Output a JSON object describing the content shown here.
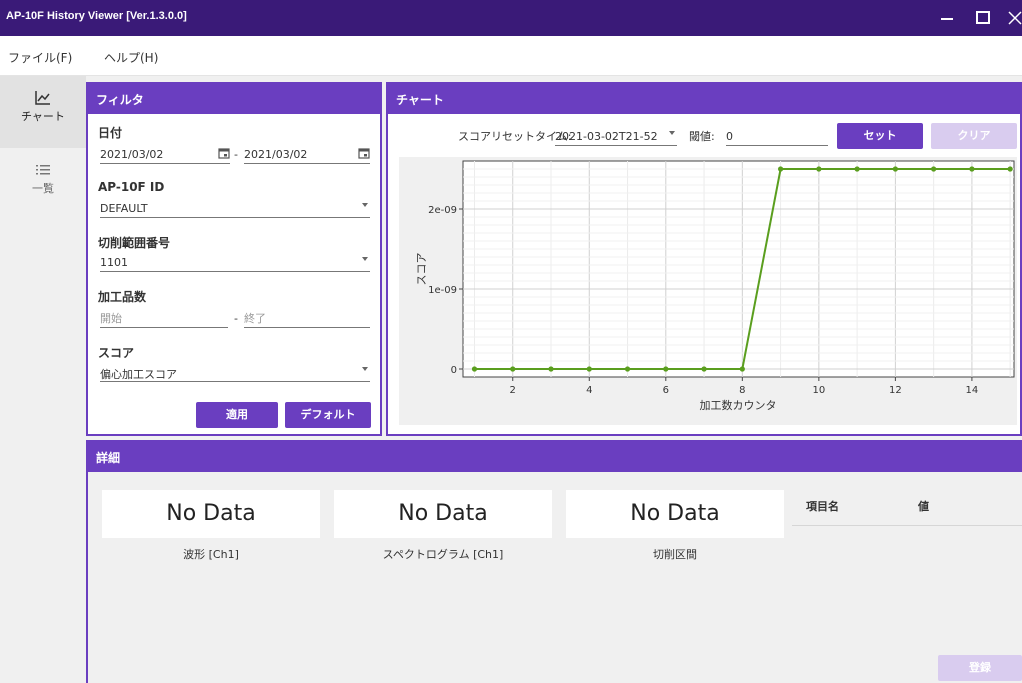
{
  "window": {
    "title": "AP-10F History Viewer [Ver.1.3.0.0]"
  },
  "menu": {
    "file": "ファイル(F)",
    "help": "ヘルプ(H)"
  },
  "nav": {
    "chart": "チャート",
    "list": "一覧"
  },
  "filter": {
    "title": "フィルタ",
    "date_label": "日付",
    "date_from": "2021/03/02",
    "date_sep": "-",
    "date_to": "2021/03/02",
    "id_label": "AP-10F ID",
    "id_value": "DEFAULT",
    "range_label": "切削範囲番号",
    "range_value": "1101",
    "count_label": "加工品数",
    "count_start_placeholder": "開始",
    "count_sep": "-",
    "count_end_placeholder": "終了",
    "score_label": "スコア",
    "score_value": "偏心加工スコア",
    "apply_button": "適用",
    "default_button": "デフォルト"
  },
  "chart_panel": {
    "title": "チャート",
    "reset_time_label": "スコアリセットタイム:",
    "reset_time_value": "2021-03-02T21-52",
    "threshold_label": "閾値:",
    "threshold_value": "0",
    "set_button": "セット",
    "clear_button": "クリア"
  },
  "chart_data": {
    "type": "line",
    "xlabel": "加工数カウンタ",
    "ylabel": "スコア",
    "xlim": [
      1,
      15
    ],
    "ylim": [
      0,
      2.5e-09
    ],
    "xticks": [
      2,
      4,
      6,
      8,
      10,
      12,
      14
    ],
    "xtick_labels": [
      "2",
      "4",
      "6",
      "8",
      "10",
      "12",
      "14"
    ],
    "yticks": [
      0,
      1e-09,
      2e-09
    ],
    "ytick_labels": [
      "0",
      "1e-09",
      "2e-09"
    ],
    "grid": true,
    "line_color": "#5a9e1e",
    "series": [
      {
        "x": [
          1,
          2,
          3,
          4,
          5,
          6,
          7,
          8,
          9,
          10,
          11,
          12,
          13,
          14,
          15
        ],
        "values": [
          0,
          0,
          0,
          0,
          0,
          0,
          0,
          0,
          2.5e-09,
          2.5e-09,
          2.5e-09,
          2.5e-09,
          2.5e-09,
          2.5e-09,
          2.5e-09
        ]
      }
    ]
  },
  "detail": {
    "title": "詳細",
    "boxes": [
      {
        "text": "No Data",
        "caption": "波形 [Ch1]"
      },
      {
        "text": "No Data",
        "caption": "スペクトログラム [Ch1]"
      },
      {
        "text": "No Data",
        "caption": "切削区間"
      }
    ],
    "col_name": "項目名",
    "col_value": "値",
    "register_button": "登録"
  },
  "colors": {
    "accent": "#6a3ec0",
    "titlebar": "#3a1a78",
    "series": "#5a9e1e"
  }
}
